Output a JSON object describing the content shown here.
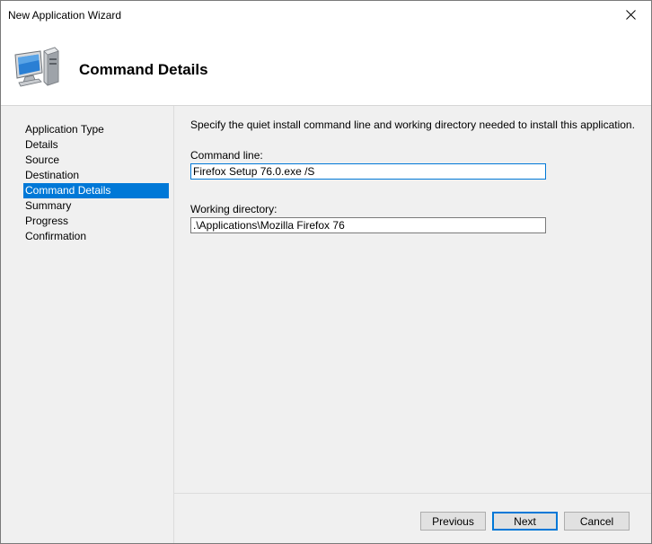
{
  "window": {
    "title": "New Application Wizard",
    "close_icon": "close-icon"
  },
  "header": {
    "title": "Command Details",
    "icon": "computer-icon"
  },
  "sidebar": {
    "items": [
      {
        "label": "Application Type",
        "active": false
      },
      {
        "label": "Details",
        "active": false
      },
      {
        "label": "Source",
        "active": false
      },
      {
        "label": "Destination",
        "active": false
      },
      {
        "label": "Command Details",
        "active": true
      },
      {
        "label": "Summary",
        "active": false
      },
      {
        "label": "Progress",
        "active": false
      },
      {
        "label": "Confirmation",
        "active": false
      }
    ]
  },
  "main": {
    "instructions": "Specify the quiet install command line and working directory needed to install this application.",
    "command_line": {
      "label": "Command line:",
      "value": "Firefox Setup 76.0.exe /S"
    },
    "working_directory": {
      "label": "Working directory:",
      "value": ".\\Applications\\Mozilla Firefox 76"
    }
  },
  "footer": {
    "previous_label": "Previous",
    "next_label": "Next",
    "cancel_label": "Cancel"
  },
  "colors": {
    "accent": "#0078d7",
    "window_bg": "#f0f0f0",
    "header_bg": "#ffffff"
  }
}
